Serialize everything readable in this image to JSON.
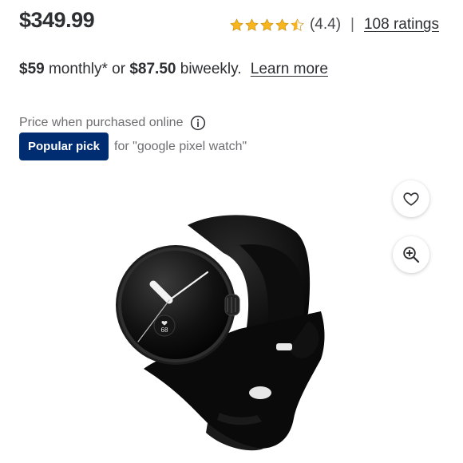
{
  "product": {
    "price": "$349.99",
    "rating_value": "(4.4)",
    "rating_separator": "|",
    "ratings_link": "108 ratings",
    "stars_filled": 4.4
  },
  "financing": {
    "monthly_amount": "$59",
    "monthly_text": " monthly* or ",
    "biweekly_amount": "$87.50",
    "biweekly_text": " biweekly.",
    "learn_more": "Learn more"
  },
  "price_note": "Price when purchased online",
  "badge": {
    "label": "Popular pick",
    "query_text": "for \"google pixel watch\""
  },
  "watch_face": {
    "heart_rate": "68"
  },
  "icons": {
    "star": "star-icon",
    "info": "info-icon",
    "favorite": "heart-icon",
    "zoom": "zoom-in-icon"
  },
  "colors": {
    "star": "#f8b51c",
    "badge_bg": "#002d72",
    "text": "#2e2f32",
    "muted": "#6d6e71"
  }
}
